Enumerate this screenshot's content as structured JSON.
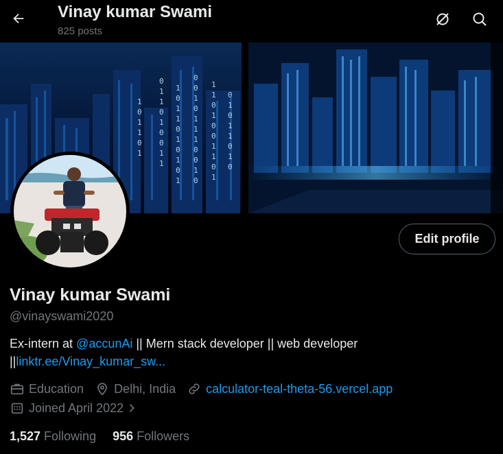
{
  "header": {
    "title": "Vinay kumar Swami",
    "posts": "825 posts",
    "back_icon": "arrow-left-icon",
    "grok_icon": "grok-icon",
    "search_icon": "search-icon"
  },
  "profile": {
    "edit_label": "Edit profile",
    "name": "Vinay kumar Swami",
    "handle": "@vinayswami2020",
    "bio": {
      "part1": "Ex-intern at ",
      "mention": "@accunAi",
      "part2": " || Mern stack developer || web developer",
      "part3": "||",
      "link": "linktr.ee/Vinay_kumar_sw..."
    },
    "category": "Education",
    "location": "Delhi, India",
    "website": "calculator-teal-theta-56.vercel.app",
    "joined": "Joined April 2022",
    "following_count": "1,527",
    "following_label": "Following",
    "followers_count": "956",
    "followers_label": "Followers"
  },
  "colors": {
    "accent": "#1d9bf0",
    "secondary_text": "#71767b",
    "primary_text": "#e7e9ea",
    "background": "#000000"
  }
}
